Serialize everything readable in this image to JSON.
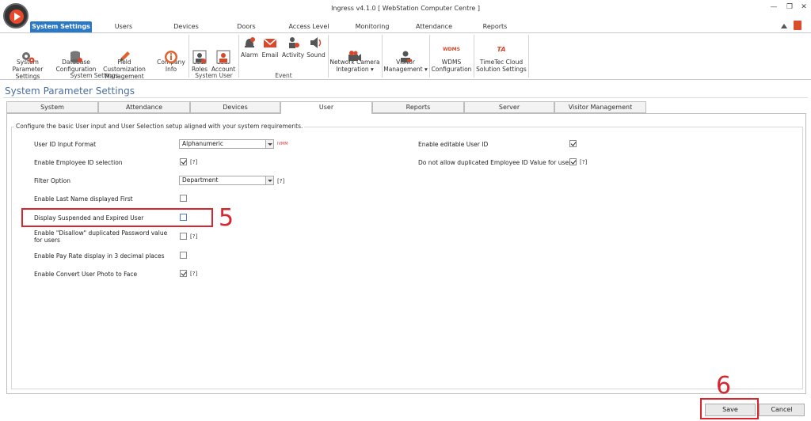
{
  "window": {
    "title": "Ingress v4.1.0 [ WebStation Computer Centre ]",
    "minimize": "—",
    "restore": "❐",
    "close": "✕"
  },
  "ribbon_tabs": [
    "System Settings",
    "Users",
    "Devices",
    "Doors",
    "Access Level",
    "Monitoring",
    "Attendance",
    "Reports"
  ],
  "ribbon": {
    "system_settings": {
      "label": "System Settings",
      "items": [
        "System Parameter\nSettings",
        "Database\nConfiguration",
        "Field Customization\nManagement",
        "Company\nInfo"
      ]
    },
    "system_user": {
      "label": "System User",
      "items": [
        "User\nRoles",
        "User\nAccount"
      ]
    },
    "event": {
      "label": "Event",
      "items": [
        "Alarm",
        "Email",
        "Activity",
        "Sound"
      ]
    },
    "others": [
      "Network Camera\nIntegration ▾",
      "Visitor\nManagement ▾",
      "WDMS\nConfiguration",
      "TimeTec Cloud\nSolution Settings"
    ],
    "wdms_logo": "WDMS",
    "ta_logo": "TA"
  },
  "page": {
    "title": "System Parameter Settings",
    "tabs": [
      "System",
      "Attendance",
      "Devices",
      "User",
      "Reports",
      "Server",
      "Visitor Management"
    ],
    "active_tab": "User",
    "description": "Configure the basic User input and User Selection setup aligned with your system requirements."
  },
  "form": {
    "user_id_format": {
      "label": "User ID Input Format",
      "value": "Alphanumeric",
      "hint": "IVMM"
    },
    "employee_id_selection": {
      "label": "Enable Employee ID selection",
      "checked": true,
      "help": "[?]"
    },
    "filter_option": {
      "label": "Filter Option",
      "value": "Department",
      "help": "[?]"
    },
    "last_name_first": {
      "label": "Enable Last Name displayed First",
      "checked": false
    },
    "suspended_expired": {
      "label": "Display Suspended and Expired User",
      "checked": false
    },
    "disallow_dup_password": {
      "label": "Enable \"Disallow\" duplicated Password value for users",
      "checked": false,
      "help": "[?]"
    },
    "pay_rate_decimal": {
      "label": "Enable Pay Rate display in 3 decimal places",
      "checked": false
    },
    "convert_photo": {
      "label": "Enable Convert User Photo to Face",
      "checked": true,
      "help": "[?]"
    },
    "editable_user_id": {
      "label": "Enable editable User ID",
      "checked": true
    },
    "no_dup_employee_id": {
      "label": "Do not allow duplicated Employee ID Value for users",
      "checked": true,
      "help": "[?]"
    }
  },
  "annotations": {
    "step5": "5",
    "step6": "6"
  },
  "buttons": {
    "save": "Save",
    "cancel": "Cancel"
  }
}
